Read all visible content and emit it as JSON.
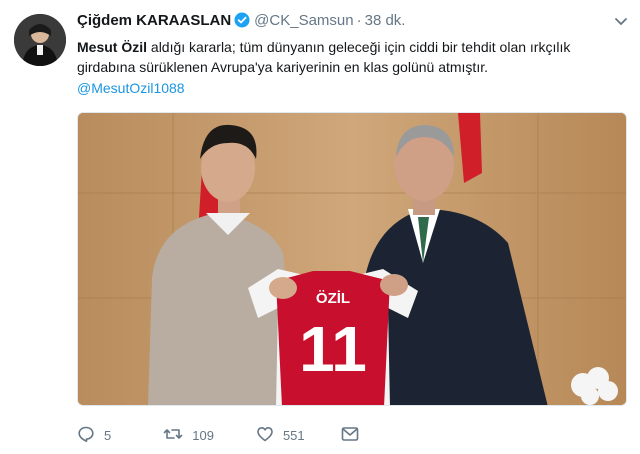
{
  "tweet": {
    "author_name": "Çiğdem KARAASLAN",
    "handle": "@CK_Samsun",
    "separator": "·",
    "time": "38 dk.",
    "text_bold": "Mesut Özil",
    "text_rest": " aldığı kararla; tüm dünyanın geleceği için ciddi bir tehdit olan ırkçılık girdabına sürüklenen Avrupa'ya kariyerinin en klas golünü atmıştır.",
    "mention": "@MesutOzil1088",
    "jersey_name": "ÖZİL",
    "jersey_number": "11"
  },
  "actions": {
    "replies": "5",
    "retweets": "109",
    "likes": "551"
  },
  "colors": {
    "link": "#1b95e0",
    "muted": "#657786",
    "verified": "#1da1f2",
    "jersey": "#c8102e"
  },
  "icons": [
    "verified-badge-icon",
    "chevron-down-icon",
    "reply-icon",
    "retweet-icon",
    "like-icon",
    "direct-message-icon"
  ]
}
